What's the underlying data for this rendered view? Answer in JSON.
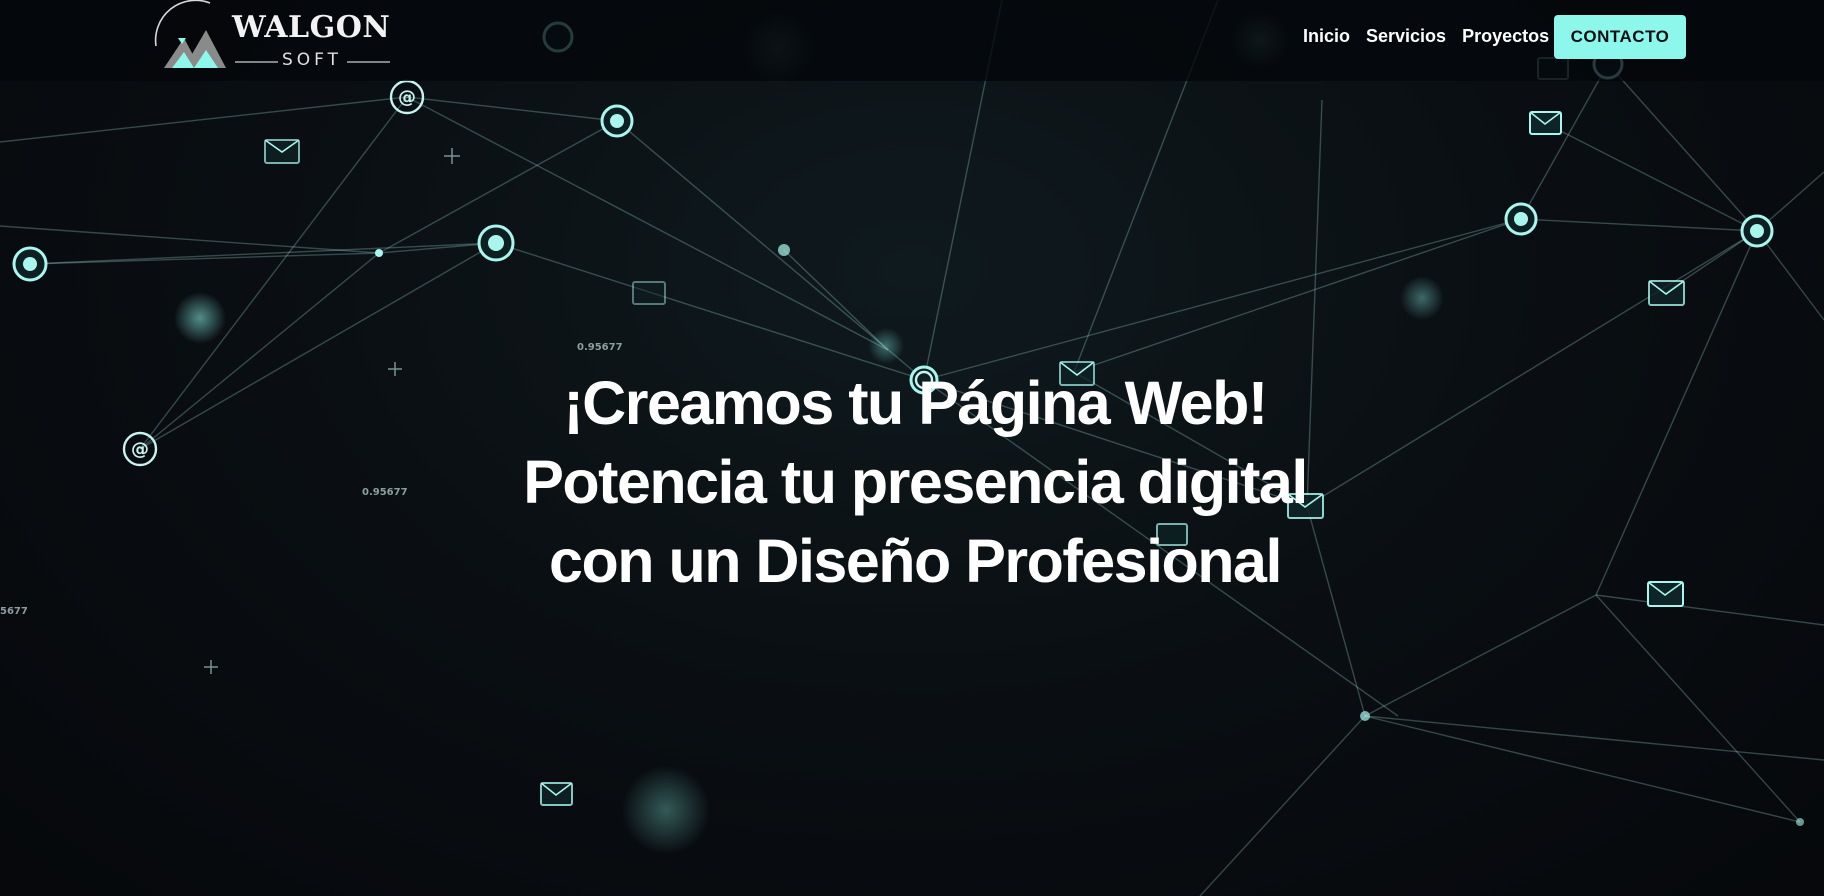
{
  "header": {
    "logo": {
      "word": "WALGON",
      "sub": "SOFT"
    },
    "nav": [
      {
        "label": "Inicio"
      },
      {
        "label": "Servicios"
      },
      {
        "label": "Proyectos"
      }
    ],
    "cta_label": "CONTACTO"
  },
  "hero": {
    "title": "¡Creamos tu Página Web! Potencia tu presencia digital con un Diseño Profesional"
  },
  "background_labels": [
    "0.95677",
    "0.95677",
    "5677"
  ],
  "colors": {
    "accent": "#8df7ec",
    "background": "#07090d",
    "text": "#ffffff"
  }
}
